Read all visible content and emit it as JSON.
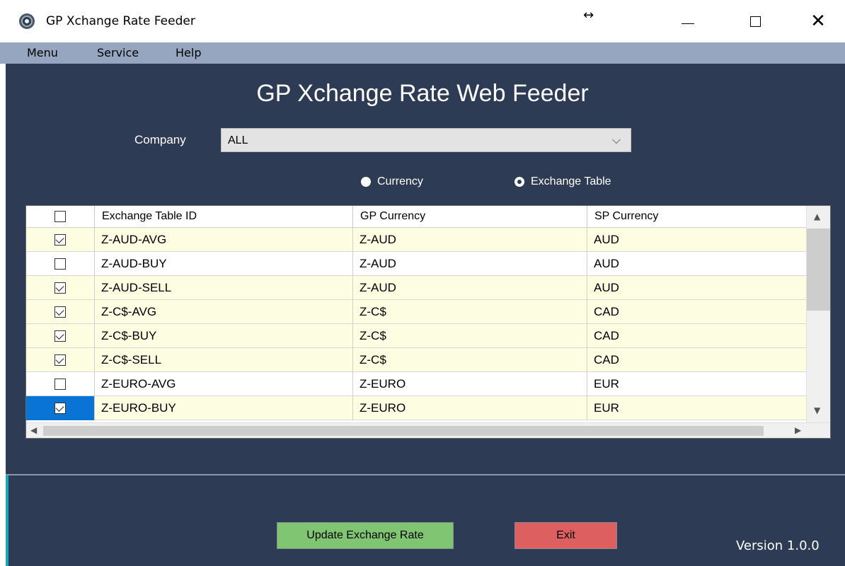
{
  "window": {
    "title": "GP Xchange Rate Feeder",
    "app_icon": "disc-icon",
    "resize_glyph": "↔",
    "min_glyph": "—",
    "close_glyph": "✕"
  },
  "menubar": {
    "items": [
      {
        "label": "Menu"
      },
      {
        "label": "Service"
      },
      {
        "label": "Help"
      }
    ]
  },
  "heading": "GP Xchange Rate Web Feeder",
  "company": {
    "label": "Company",
    "value": "ALL"
  },
  "view_mode": {
    "options": [
      {
        "label": "Currency",
        "selected": false
      },
      {
        "label": "Exchange Table",
        "selected": true
      }
    ]
  },
  "grid": {
    "columns": [
      "Exchange Table ID",
      "GP Currency",
      "SP Currency"
    ],
    "header_checked": false,
    "rows": [
      {
        "checked": true,
        "id": "Z-AUD-AVG",
        "gp": "Z-AUD",
        "sp": "AUD",
        "highlight": true
      },
      {
        "checked": false,
        "id": "Z-AUD-BUY",
        "gp": "Z-AUD",
        "sp": "AUD",
        "highlight": false
      },
      {
        "checked": true,
        "id": "Z-AUD-SELL",
        "gp": "Z-AUD",
        "sp": "AUD",
        "highlight": true
      },
      {
        "checked": true,
        "id": "Z-C$-AVG",
        "gp": "Z-C$",
        "sp": "CAD",
        "highlight": true
      },
      {
        "checked": true,
        "id": "Z-C$-BUY",
        "gp": "Z-C$",
        "sp": "CAD",
        "highlight": true
      },
      {
        "checked": true,
        "id": "Z-C$-SELL",
        "gp": "Z-C$",
        "sp": "CAD",
        "highlight": true
      },
      {
        "checked": false,
        "id": "Z-EURO-AVG",
        "gp": "Z-EURO",
        "sp": "EUR",
        "highlight": false
      },
      {
        "checked": true,
        "id": "Z-EURO-BUY",
        "gp": "Z-EURO",
        "sp": "EUR",
        "highlight": true,
        "selected": true
      }
    ]
  },
  "buttons": {
    "update": "Update Exchange Rate",
    "exit": "Exit"
  },
  "version": "Version 1.0.0",
  "colors": {
    "panel": "#2d3b55",
    "menubar": "#96a6c0",
    "row_highlight": "#fdfde1",
    "update_button": "#7fc572",
    "exit_button": "#dd5f5f",
    "selection": "#0a74d6"
  }
}
